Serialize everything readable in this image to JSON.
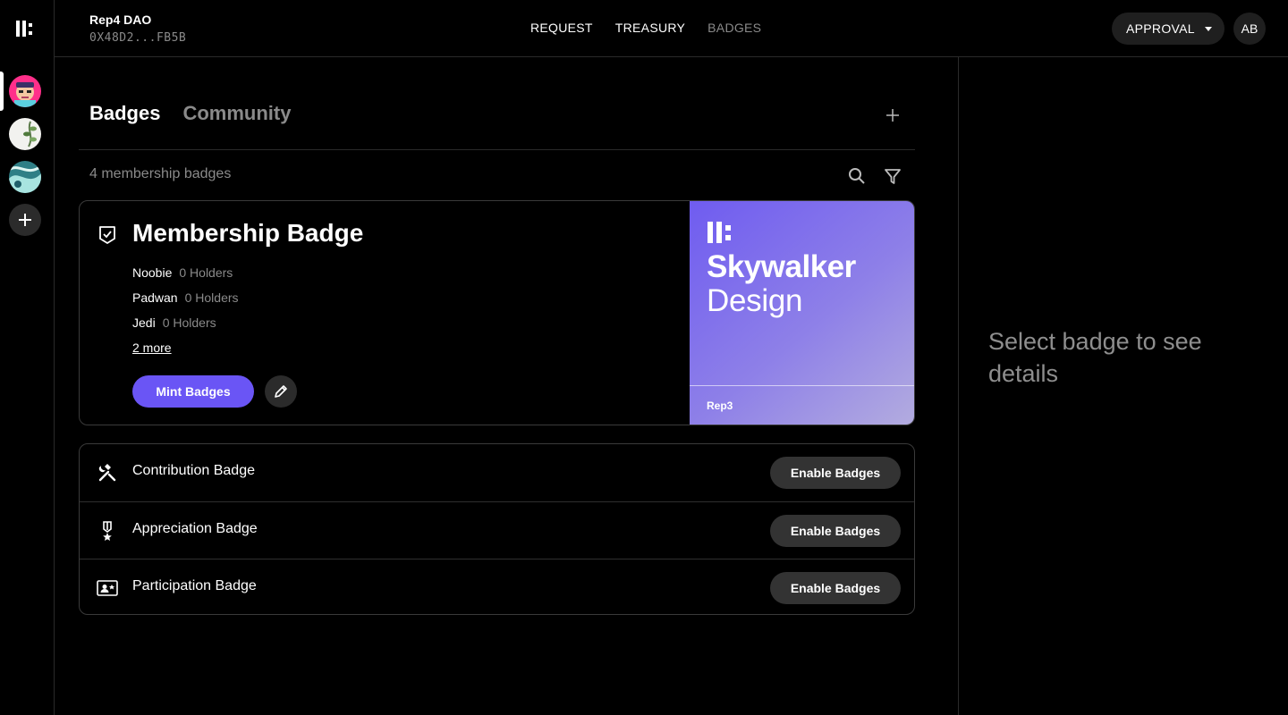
{
  "rail": {
    "logo_icon": "app-logo-icon",
    "daos": [
      {
        "name": "dao-avatar-1",
        "icon": "pink-character-avatar"
      },
      {
        "name": "dao-avatar-2",
        "icon": "plant-avatar"
      },
      {
        "name": "dao-avatar-3",
        "icon": "teal-abstract-avatar"
      }
    ],
    "add_icon": "plus-icon"
  },
  "header": {
    "dao_name": "Rep4 DAO",
    "dao_address": "0X48D2...FB5B",
    "nav": [
      {
        "label": "REQUEST",
        "active": false
      },
      {
        "label": "TREASURY",
        "active": false
      },
      {
        "label": "BADGES",
        "active": true
      }
    ],
    "approval_label": "APPROVAL",
    "user_initials": "AB"
  },
  "main": {
    "tabs": [
      {
        "label": "Badges",
        "active": true
      },
      {
        "label": "Community",
        "active": false
      }
    ],
    "count_text": "4 membership badges",
    "membership": {
      "title": "Membership Badge",
      "levels": [
        {
          "name": "Noobie",
          "holders": "0 Holders"
        },
        {
          "name": "Padwan",
          "holders": "0 Holders"
        },
        {
          "name": "Jedi",
          "holders": "0 Holders"
        }
      ],
      "more_label": "2 more",
      "mint_label": "Mint Badges",
      "art": {
        "line1": "Skywalker",
        "line2": "Design",
        "footer": "Rep3"
      }
    },
    "badges": [
      {
        "label": "Contribution Badge",
        "icon": "tools-icon",
        "button": "Enable Badges"
      },
      {
        "label": "Appreciation Badge",
        "icon": "medal-icon",
        "button": "Enable Badges"
      },
      {
        "label": "Participation Badge",
        "icon": "id-card-icon",
        "button": "Enable Badges"
      }
    ]
  },
  "side_panel": {
    "hint": "Select badge to see details"
  },
  "colors": {
    "accent": "#6A55F5",
    "background": "#000000",
    "muted_text": "#8A8A8A",
    "button_dark": "#333333"
  }
}
